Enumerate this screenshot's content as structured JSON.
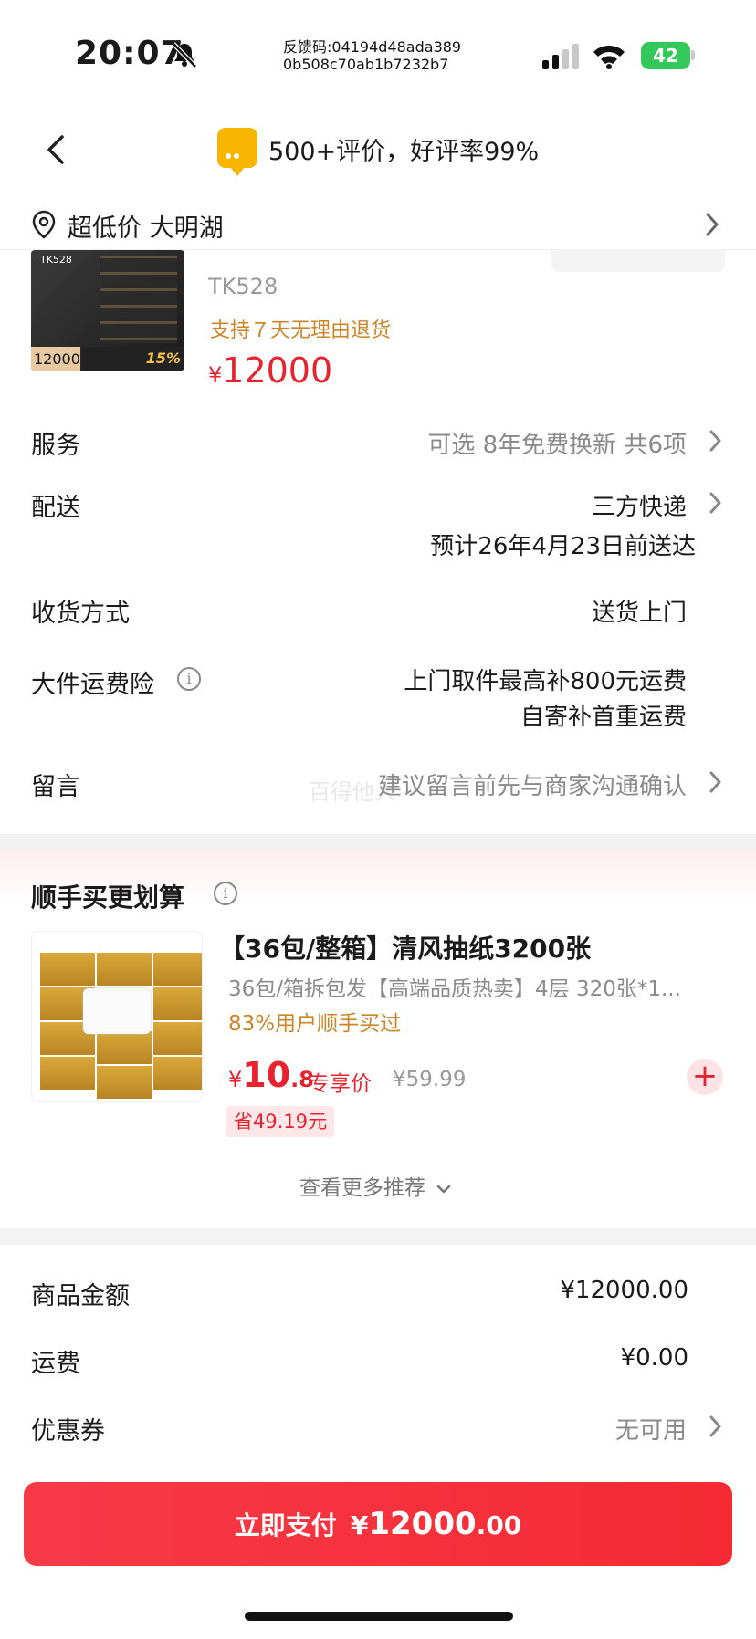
{
  "status_bar": {
    "time": "20:07",
    "feedback_line1": "反馈码:04194d48ada389",
    "feedback_line2": "0b508c70ab1b7232b7",
    "battery": "42"
  },
  "nav": {
    "rating": "500+评价，好评率99%"
  },
  "address": {
    "text": "超低价 大明湖"
  },
  "product": {
    "image_tag": "TK528",
    "image_price": "12000",
    "image_discount": "15%",
    "sku": "TK528",
    "return_policy": "支持７天无理由退货",
    "price_currency": "¥",
    "price": "12000"
  },
  "rows": {
    "service_label": "服务",
    "service_value": "可选 8年免费换新 共6项",
    "delivery_label": "配送",
    "delivery_value": "三方快递",
    "delivery_eta": "预计26年4月23日前送达",
    "receive_label": "收货方式",
    "receive_value": "送货上门",
    "insurance_label": "大件运费险",
    "insurance_line1": "上门取件最高补800元运费",
    "insurance_line2": "自寄补首重运费",
    "message_label": "留言",
    "message_placeholder": "建议留言前先与商家沟通确认",
    "watermark": "百得他人"
  },
  "recommend": {
    "title": "顺手买更划算",
    "name": "【36包/整箱】清风抽纸3200张",
    "desc": "36包/箱拆包发【高端品质热卖】4层 320张*1...",
    "social": "83%用户顺手买过",
    "price_currency": "¥",
    "price_int": "10",
    "price_dec": ".8",
    "price_tag": "专享价",
    "orig_price": "¥59.99",
    "save": "省49.19元",
    "more": "查看更多推荐"
  },
  "summary": {
    "goods_label": "商品金额",
    "goods_value": "¥12000.00",
    "shipping_label": "运费",
    "shipping_value": "¥0.00",
    "coupon_label": "优惠券",
    "coupon_value": "无可用"
  },
  "pay": {
    "label": "立即支付",
    "currency": "¥",
    "amount_int": "12000",
    "amount_dec": ".00"
  },
  "colors": {
    "accent": "#e8232f",
    "gold": "#c9862a"
  }
}
